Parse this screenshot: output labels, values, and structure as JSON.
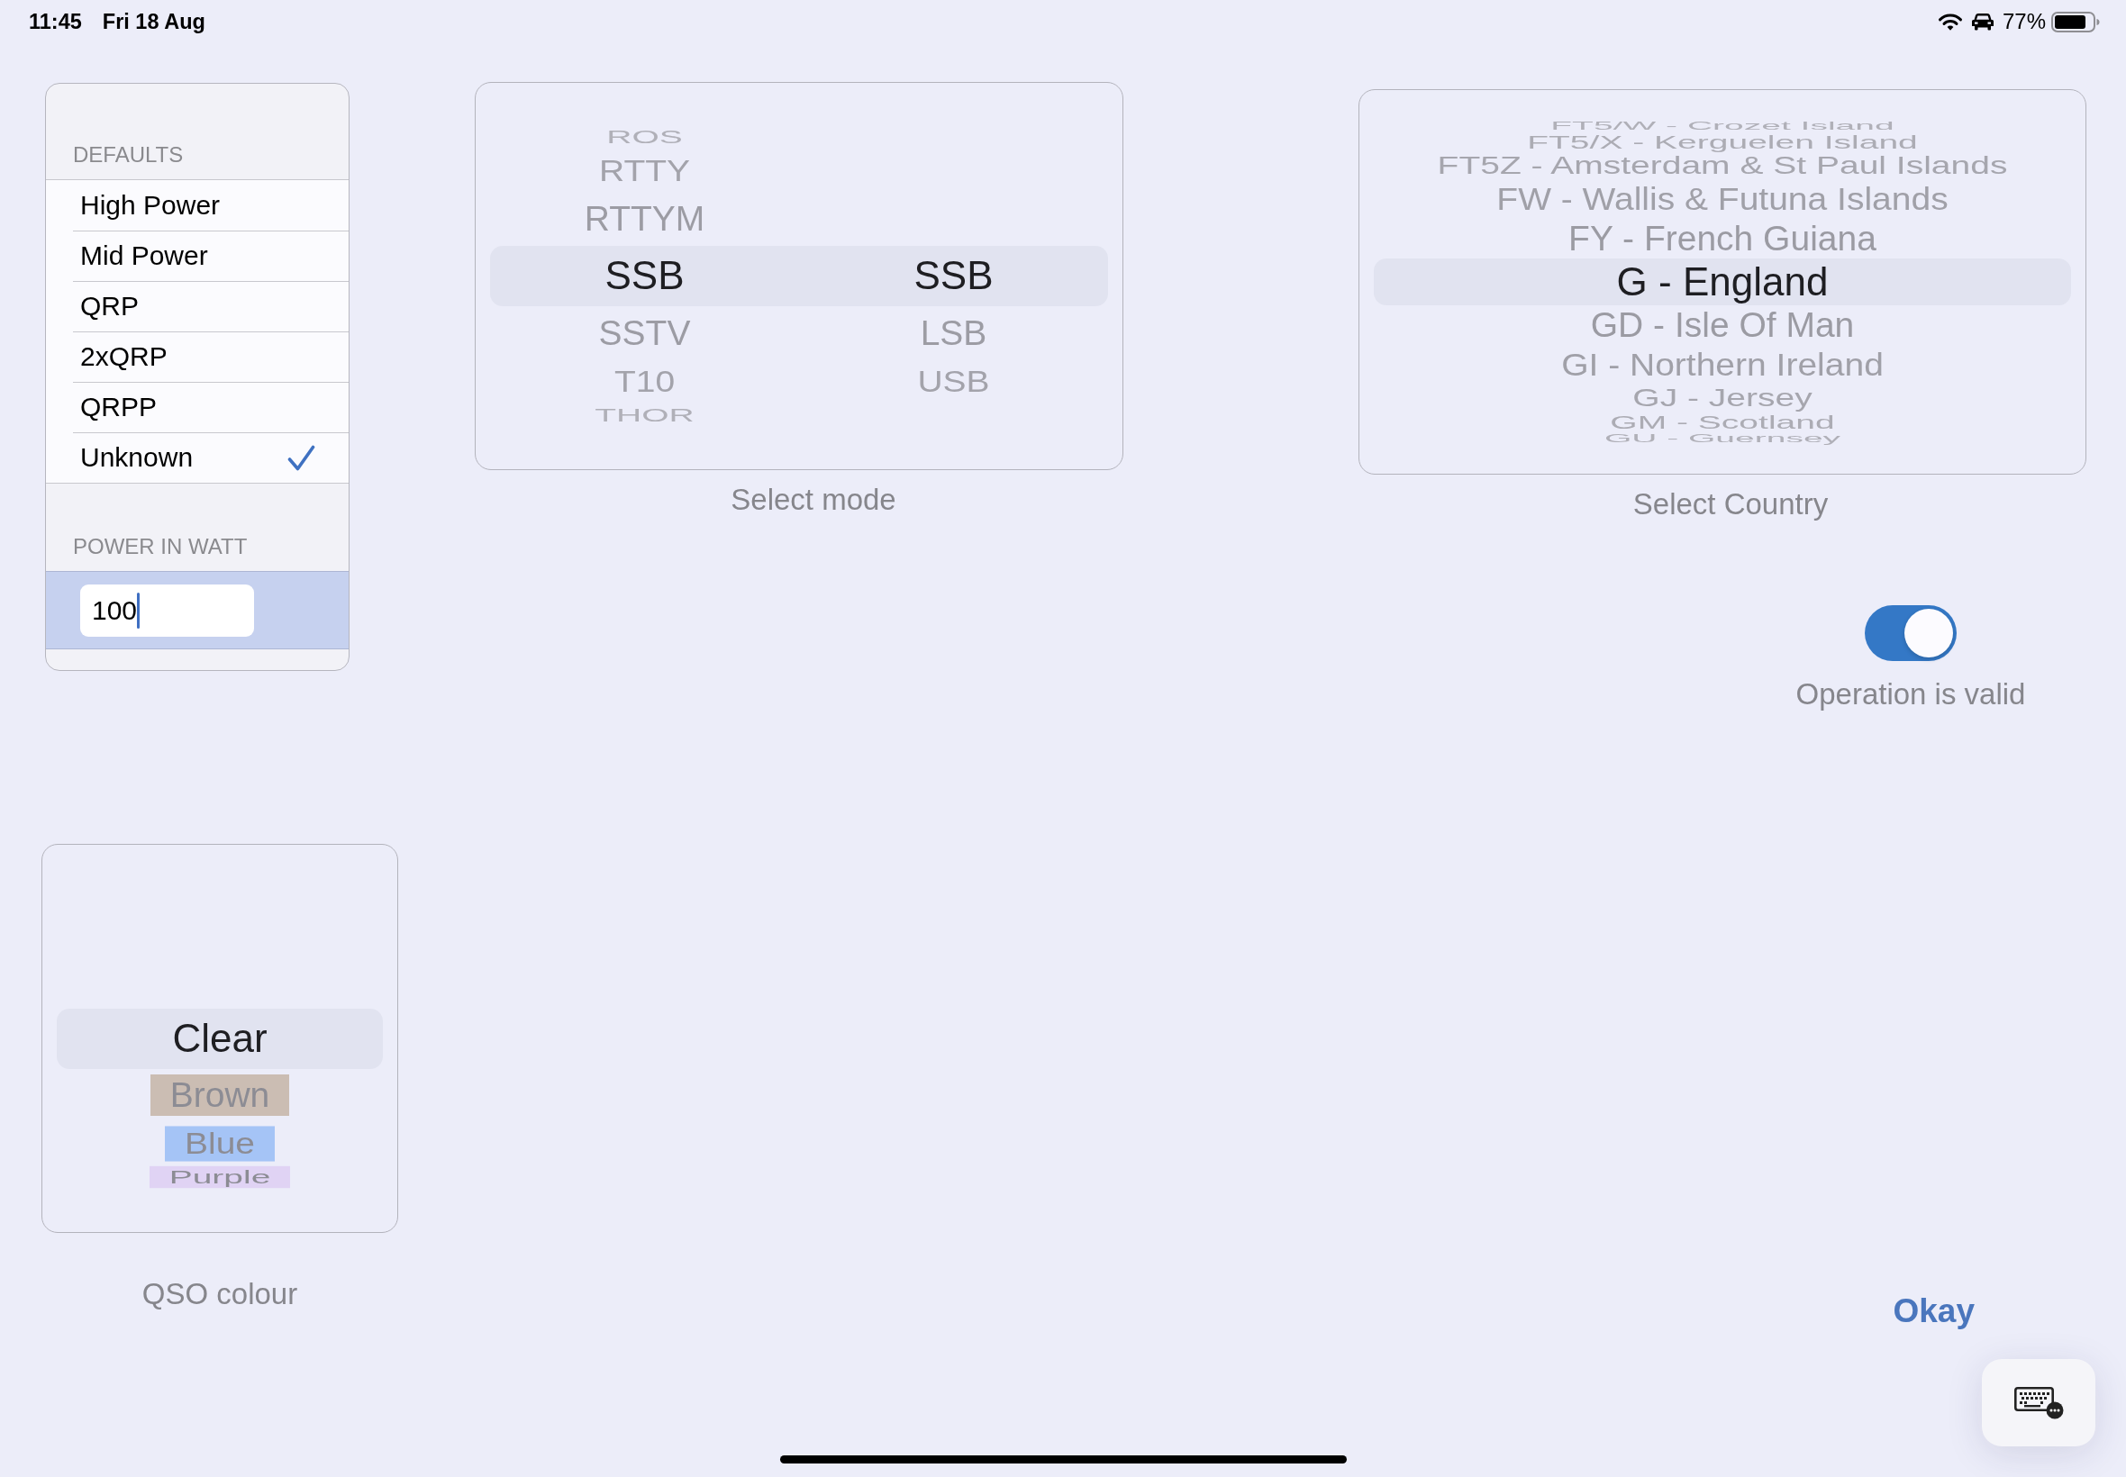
{
  "status_bar": {
    "time": "11:45",
    "date": "Fri 18 Aug",
    "battery": "77%"
  },
  "defaults_panel": {
    "sections": [
      {
        "kind": "options",
        "header": "DEFAULTS",
        "items": [
          {
            "label": "High Power",
            "checked": false
          },
          {
            "label": "Mid Power",
            "checked": false
          },
          {
            "label": "QRP",
            "checked": false
          },
          {
            "label": "2xQRP",
            "checked": false
          },
          {
            "label": "QRPP",
            "checked": false
          },
          {
            "label": "Unknown",
            "checked": true
          }
        ]
      },
      {
        "kind": "field",
        "header": "POWER IN WATT",
        "value": "100",
        "focused": true
      }
    ]
  },
  "mode_picker": {
    "columns": [
      {
        "items": [
          {
            "label": "ROS",
            "selected": false
          },
          {
            "label": "RTTY",
            "selected": false
          },
          {
            "label": "RTTYM",
            "selected": false
          },
          {
            "label": "SSB",
            "selected": true
          },
          {
            "label": "SSTV",
            "selected": false
          },
          {
            "label": "T10",
            "selected": false
          },
          {
            "label": "THOR",
            "selected": false
          }
        ]
      },
      {
        "items": [
          {
            "label": "SSB",
            "selected": true
          },
          {
            "label": "LSB",
            "selected": false
          },
          {
            "label": "USB",
            "selected": false
          }
        ]
      }
    ],
    "caption": "Select mode"
  },
  "country_picker": {
    "columns": [
      {
        "items": [
          {
            "label": "FT5/W - Crozet Island",
            "selected": false
          },
          {
            "label": "FT5/X - Kerguelen Island",
            "selected": false
          },
          {
            "label": "FT5Z - Amsterdam & St Paul Islands",
            "selected": false
          },
          {
            "label": "FW - Wallis & Futuna Islands",
            "selected": false
          },
          {
            "label": "FY - French Guiana",
            "selected": false
          },
          {
            "label": "G - England",
            "selected": true
          },
          {
            "label": "GD - Isle Of Man",
            "selected": false
          },
          {
            "label": "GI - Northern Ireland",
            "selected": false
          },
          {
            "label": "GJ - Jersey",
            "selected": false
          },
          {
            "label": "GM - Scotland",
            "selected": false
          },
          {
            "label": "GU - Guernsey",
            "selected": false
          }
        ]
      }
    ],
    "caption": "Select Country"
  },
  "operation_switch": {
    "on": true,
    "label": "Operation is valid"
  },
  "qso_colour_picker": {
    "columns": [
      {
        "items": [
          {
            "label": "Clear",
            "selected": true
          },
          {
            "label": "Brown",
            "selected": false,
            "color": "#cbbdb3"
          },
          {
            "label": "Blue",
            "selected": false,
            "color": "#a5c4f6"
          },
          {
            "label": "Purple",
            "selected": false,
            "color": "#e0d3f4"
          }
        ]
      }
    ],
    "caption": "QSO colour"
  },
  "okay_button": {
    "label": "Okay"
  }
}
